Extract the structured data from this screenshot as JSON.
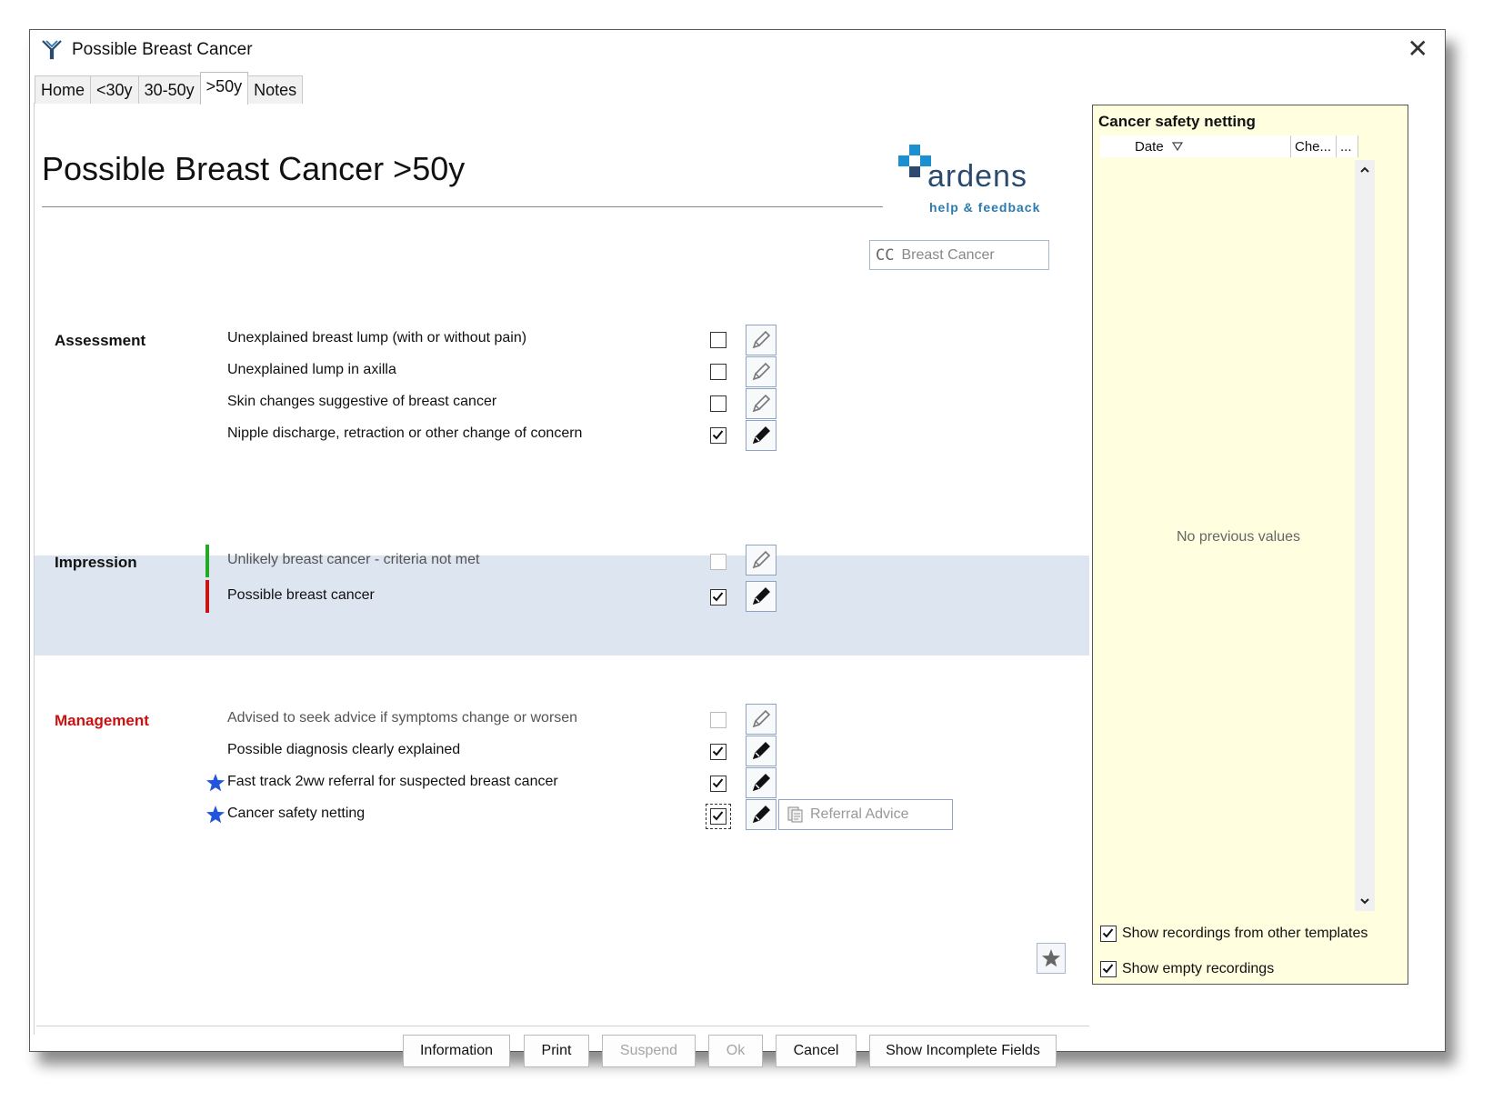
{
  "window": {
    "title": "Possible Breast Cancer"
  },
  "tabs": [
    "Home",
    "<30y",
    "30-50y",
    ">50y",
    "Notes"
  ],
  "page_title": "Possible Breast Cancer >50y",
  "logo": {
    "word": "ardens",
    "help": "help & feedback"
  },
  "cc_button": {
    "prefix": "CC",
    "label": "Breast Cancer"
  },
  "assessment": {
    "label": "Assessment",
    "items": [
      {
        "label": "Unexplained breast lump (with or without pain)",
        "checked": false
      },
      {
        "label": "Unexplained lump in axilla",
        "checked": false
      },
      {
        "label": "Skin changes suggestive of breast cancer",
        "checked": false
      },
      {
        "label": "Nipple discharge, retraction or other change of concern",
        "checked": true
      }
    ]
  },
  "impression": {
    "label": "Impression",
    "items": [
      {
        "label": "Unlikely breast cancer - criteria not met",
        "checked": false,
        "bar_color": "#22aa22"
      },
      {
        "label": "Possible breast cancer",
        "checked": true,
        "bar_color": "#cc1111"
      }
    ]
  },
  "management": {
    "label": "Management",
    "items": [
      {
        "label": "Advised to seek advice if symptoms change or worsen",
        "checked": false
      },
      {
        "label": "Possible diagnosis clearly explained",
        "checked": true
      },
      {
        "label": "Fast track 2ww referral for suspected breast cancer",
        "checked": true
      },
      {
        "label": "Cancer safety netting",
        "checked": true
      }
    ],
    "referral_button": "Referral Advice"
  },
  "footer_buttons": {
    "information": "Information",
    "print": "Print",
    "suspend": "Suspend",
    "ok": "Ok",
    "cancel": "Cancel",
    "show_incomplete": "Show Incomplete Fields"
  },
  "side_panel": {
    "title": "Cancer safety netting",
    "columns": [
      "Date",
      "Che...",
      "..."
    ],
    "empty_text": "No previous values",
    "show_other_templates": "Show recordings from other templates",
    "show_empty": "Show empty recordings"
  },
  "colors": {
    "accent_blue": "#2255dd",
    "red": "#cc1111",
    "green": "#22aa22",
    "panel_bg": "#ffffe0",
    "band_bg": "#dde5f0"
  }
}
